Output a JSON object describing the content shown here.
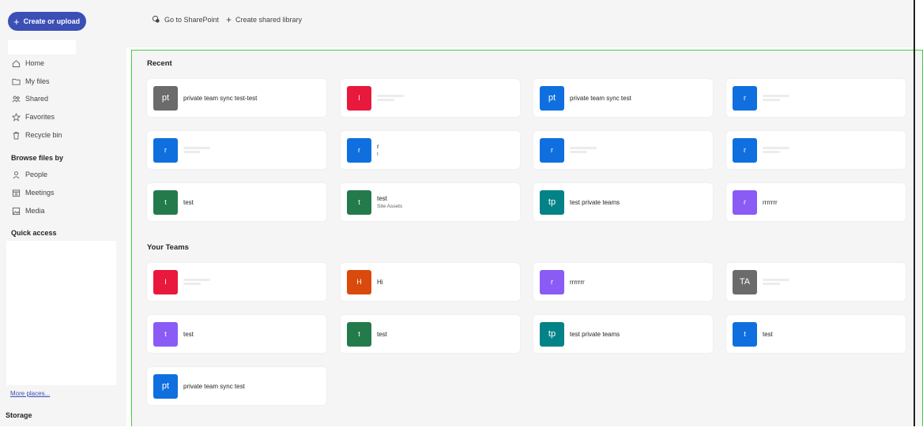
{
  "sidebar": {
    "create_label": "Create or upload",
    "nav": [
      {
        "label": "Home",
        "icon": "home-icon"
      },
      {
        "label": "My files",
        "icon": "folder-icon"
      },
      {
        "label": "Shared",
        "icon": "people-icon"
      },
      {
        "label": "Favorites",
        "icon": "star-icon"
      },
      {
        "label": "Recycle bin",
        "icon": "trash-icon"
      }
    ],
    "browse_heading": "Browse files by",
    "browse": [
      {
        "label": "People",
        "icon": "person-icon"
      },
      {
        "label": "Meetings",
        "icon": "calendar-icon"
      },
      {
        "label": "Media",
        "icon": "image-icon"
      }
    ],
    "quick_access_heading": "Quick access",
    "more_places": "More places...",
    "storage_heading": "Storage"
  },
  "topbar": {
    "sharepoint_label": "Go to SharePoint",
    "create_library_label": "Create shared library"
  },
  "recent": {
    "heading": "Recent",
    "cards": [
      {
        "initials": "pt",
        "color": "#6b6b6b",
        "title": "private team sync test-test",
        "sub": ""
      },
      {
        "initials": "I",
        "color": "#e8193c",
        "title": "",
        "sub": ""
      },
      {
        "initials": "pt",
        "color": "#0f6fdf",
        "title": "private team sync test",
        "sub": ""
      },
      {
        "initials": "r",
        "color": "#0f6fdf",
        "title": "",
        "sub": ""
      },
      {
        "initials": "r",
        "color": "#0f6fdf",
        "title": "",
        "sub": ""
      },
      {
        "initials": "r",
        "color": "#0f6fdf",
        "title": "r",
        "sub": "t"
      },
      {
        "initials": "r",
        "color": "#0f6fdf",
        "title": "",
        "sub": ""
      },
      {
        "initials": "r",
        "color": "#0f6fdf",
        "title": "",
        "sub": ""
      },
      {
        "initials": "t",
        "color": "#237b4b",
        "title": "test",
        "sub": ""
      },
      {
        "initials": "t",
        "color": "#237b4b",
        "title": "test",
        "sub": "Site Assets"
      },
      {
        "initials": "tp",
        "color": "#038387",
        "title": "test private teams",
        "sub": ""
      },
      {
        "initials": "r",
        "color": "#8a5cf5",
        "title": "rrrrrrr",
        "sub": ""
      }
    ]
  },
  "teams": {
    "heading": "Your Teams",
    "cards": [
      {
        "initials": "I",
        "color": "#e8193c",
        "title": "",
        "sub": ""
      },
      {
        "initials": "H",
        "color": "#da4a0c",
        "title": "Hi",
        "sub": ""
      },
      {
        "initials": "r",
        "color": "#8a5cf5",
        "title": "rrrrrrr",
        "sub": ""
      },
      {
        "initials": "TA",
        "color": "#6b6b6b",
        "title": "",
        "sub": ""
      },
      {
        "initials": "t",
        "color": "#8a5cf5",
        "title": "test",
        "sub": ""
      },
      {
        "initials": "t",
        "color": "#237b4b",
        "title": "test",
        "sub": ""
      },
      {
        "initials": "tp",
        "color": "#038387",
        "title": "test private teams",
        "sub": ""
      },
      {
        "initials": "t",
        "color": "#0f6fdf",
        "title": "test",
        "sub": ""
      },
      {
        "initials": "pt",
        "color": "#0f6fdf",
        "title": "private team sync test",
        "sub": ""
      }
    ]
  }
}
